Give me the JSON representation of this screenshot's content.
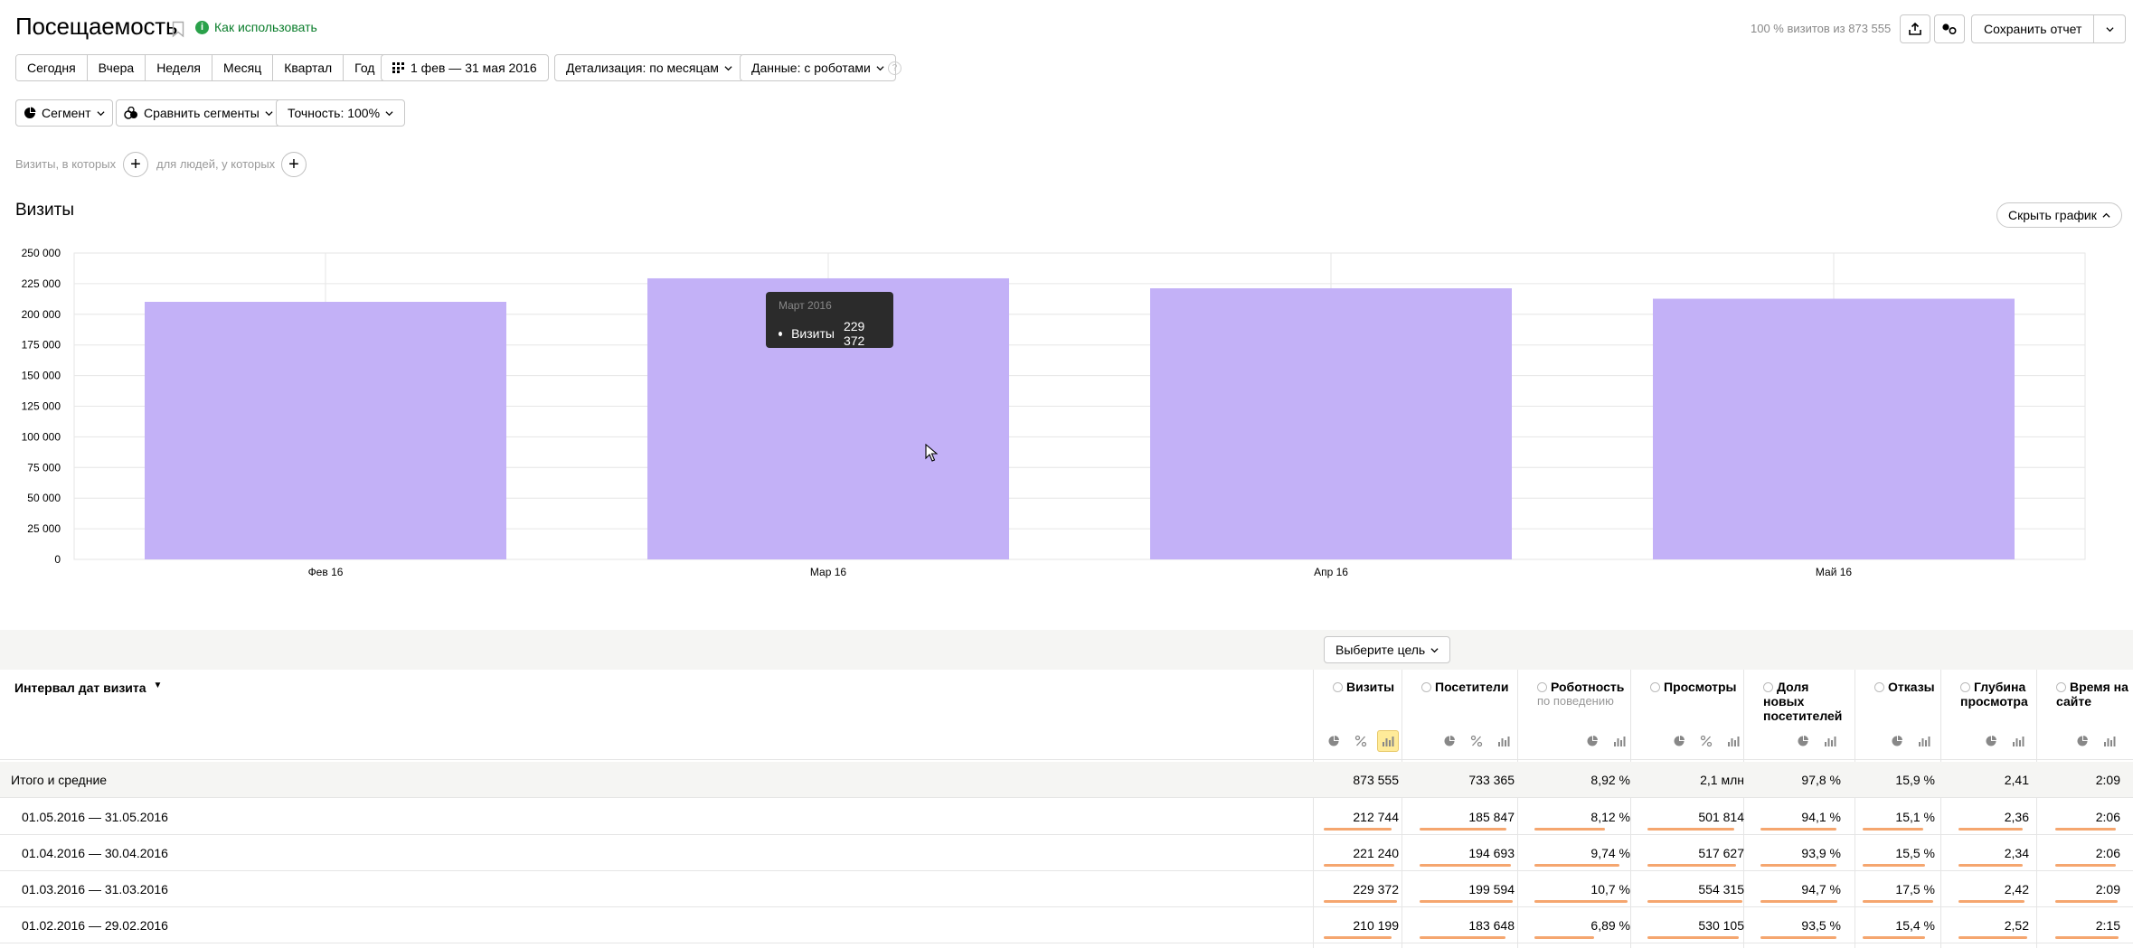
{
  "header": {
    "title": "Посещаемость",
    "how_to_use": "Как использовать",
    "visits_info": "100 % визитов из 873 555",
    "save_report": "Сохранить отчет"
  },
  "toolbar": {
    "periods": [
      "Сегодня",
      "Вчера",
      "Неделя",
      "Месяц",
      "Квартал",
      "Год"
    ],
    "date_range": "1 фев — 31 мая 2016",
    "detail": "Детализация: по месяцам",
    "data": "Данные: с роботами",
    "segment": "Сегмент",
    "compare": "Сравнить сегменты",
    "accuracy": "Точность: 100%"
  },
  "segment_filter": {
    "visits_label": "Визиты, в которых",
    "people_label": "для людей, у которых"
  },
  "chart_section": {
    "title": "Визиты",
    "hide_chart": "Скрыть график"
  },
  "tooltip": {
    "month": "Март 2016",
    "series": "Визиты",
    "value": "229 372"
  },
  "colors": {
    "bar": "#c3b1f7",
    "accent_bar": "#f5a66f",
    "tooltip_bg": "#2b2b2b"
  },
  "chart_data": {
    "type": "bar",
    "categories": [
      "Фев 16",
      "Мар 16",
      "Апр 16",
      "Май 16"
    ],
    "values": [
      210199,
      229372,
      221240,
      212744
    ],
    "ylim": [
      0,
      250000
    ],
    "yticks": [
      0,
      25000,
      50000,
      75000,
      100000,
      125000,
      150000,
      175000,
      200000,
      225000,
      250000
    ],
    "ytick_labels": [
      "0",
      "25 000",
      "50 000",
      "75 000",
      "100 000",
      "125 000",
      "150 000",
      "175 000",
      "200 000",
      "225 000",
      "250 000"
    ],
    "grid": true,
    "series": [
      {
        "name": "Визиты",
        "values": [
          210199,
          229372,
          221240,
          212744
        ]
      }
    ]
  },
  "table": {
    "goal_button": "Выберите цель",
    "dimension_header": "Интервал дат визита",
    "columns": [
      {
        "title": "Визиты",
        "sub": ""
      },
      {
        "title": "Посетители",
        "sub": ""
      },
      {
        "title": "Роботность",
        "sub": "по поведению"
      },
      {
        "title": "Просмотры",
        "sub": ""
      },
      {
        "title": "Доля новых посетителей",
        "sub": ""
      },
      {
        "title": "Отказы",
        "sub": ""
      },
      {
        "title": "Глубина просмотра",
        "sub": ""
      },
      {
        "title": "Время на сайте",
        "sub": ""
      }
    ],
    "totals": {
      "label": "Итого и средние",
      "values": [
        "873 555",
        "733 365",
        "8,92 %",
        "2,1 млн",
        "97,8 %",
        "15,9 %",
        "2,41",
        "2:09"
      ]
    },
    "rows": [
      {
        "label": "01.05.2016 — 31.05.2016",
        "values": [
          "212 744",
          "185 847",
          "8,12 %",
          "501 814",
          "94,1 %",
          "15,1 %",
          "2,36",
          "2:06"
        ],
        "fill": [
          0.93,
          0.93,
          0.76,
          0.91,
          0.96,
          0.86,
          0.94,
          0.96
        ]
      },
      {
        "label": "01.04.2016 — 30.04.2016",
        "values": [
          "221 240",
          "194 693",
          "9,74 %",
          "517 627",
          "93,9 %",
          "15,5 %",
          "2,34",
          "2:06"
        ],
        "fill": [
          0.96,
          0.98,
          0.91,
          0.93,
          0.96,
          0.89,
          0.93,
          0.96
        ]
      },
      {
        "label": "01.03.2016 — 31.03.2016",
        "values": [
          "229 372",
          "199 594",
          "10,7 %",
          "554 315",
          "94,7 %",
          "17,5 %",
          "2,42",
          "2:09"
        ],
        "fill": [
          1.0,
          1.0,
          1.0,
          1.0,
          0.97,
          1.0,
          0.96,
          0.98
        ]
      },
      {
        "label": "01.02.2016 — 29.02.2016",
        "values": [
          "210 199",
          "183 648",
          "6,89 %",
          "530 105",
          "93,5 %",
          "15,4 %",
          "2,52",
          "2:15"
        ],
        "fill": [
          0.92,
          0.92,
          0.64,
          0.96,
          0.96,
          0.88,
          1.0,
          1.0
        ]
      }
    ]
  }
}
